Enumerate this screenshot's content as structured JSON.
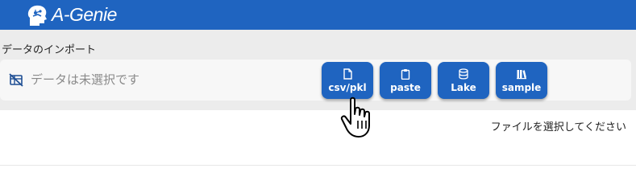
{
  "header": {
    "app_name": "A-Genie",
    "logo_icon": "brain-head-icon",
    "bg_color": "#1f64c0"
  },
  "import_section": {
    "title": "データのインポート",
    "status_text": "データは未選択です",
    "status_icon": "no-data-icon",
    "buttons": [
      {
        "label": "csv/pkl",
        "icon": "file-icon"
      },
      {
        "label": "paste",
        "icon": "clipboard-icon"
      },
      {
        "label": "Lake",
        "icon": "database-icon"
      },
      {
        "label": "sample",
        "icon": "books-icon"
      }
    ]
  },
  "hint_text": "ファイルを選択してください"
}
